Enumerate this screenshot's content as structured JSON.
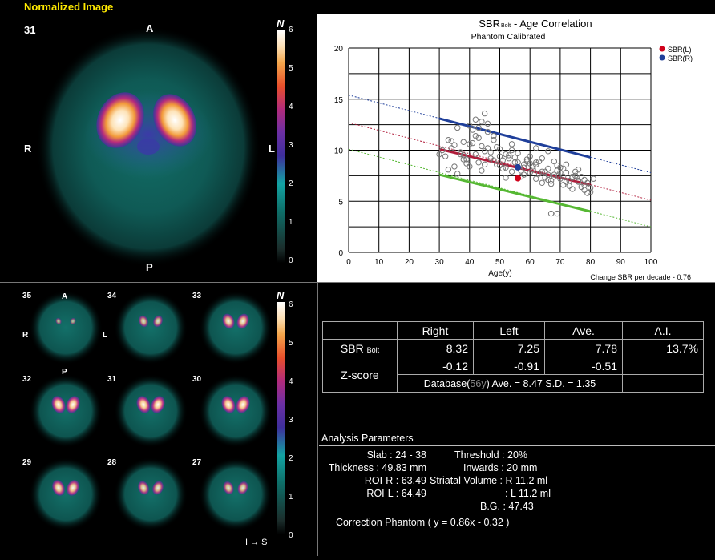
{
  "header": {
    "title": "Normalized Image"
  },
  "main_image": {
    "slice_number": "31",
    "orientation": {
      "anterior": "A",
      "posterior": "P",
      "right": "R",
      "left": "L"
    },
    "colorbar": {
      "label": "N",
      "ticks": [
        "6",
        "5",
        "4",
        "3",
        "2",
        "1",
        "0"
      ]
    }
  },
  "thumbnails": {
    "orientation": {
      "anterior": "A",
      "posterior": "P",
      "right": "R",
      "left": "L"
    },
    "slices": [
      "35",
      "34",
      "33",
      "32",
      "31",
      "30",
      "29",
      "28",
      "27"
    ],
    "colorbar": {
      "label": "N",
      "ticks": [
        "6",
        "5",
        "4",
        "3",
        "2",
        "1",
        "0"
      ]
    },
    "direction_label": "I → S"
  },
  "chart": {
    "title_main": "SBR",
    "title_sub": "Bolt",
    "title_rest": " - Age Correlation",
    "subtitle": "Phantom Calibrated",
    "xlabel": "Age(y)",
    "footnote": "Change SBR per decade - 0.76",
    "legend": [
      {
        "label": "SBR(L)",
        "color": "#d0021b"
      },
      {
        "label": "SBR(R)",
        "color": "#1f3f9a"
      }
    ]
  },
  "chart_data": {
    "type": "scatter",
    "title": "SBRBolt - Age Correlation",
    "subtitle": "Phantom Calibrated",
    "xlabel": "Age(y)",
    "ylabel": "",
    "xlim": [
      0,
      100
    ],
    "ylim": [
      0,
      20
    ],
    "xticks": [
      0,
      10,
      20,
      30,
      40,
      50,
      60,
      70,
      80,
      90,
      100
    ],
    "yticks": [
      0,
      5,
      10,
      15,
      20
    ],
    "grid": true,
    "legend_position": "top-right",
    "regression_lines": [
      {
        "name": "upper",
        "color": "#1f3f9a",
        "x": [
          30,
          80
        ],
        "y": [
          13.1,
          9.3
        ],
        "extended_x": [
          0,
          100
        ],
        "extended_y": [
          15.4,
          7.8
        ]
      },
      {
        "name": "mean",
        "color": "#b01b3a",
        "x": [
          30,
          80
        ],
        "y": [
          10.1,
          6.6
        ],
        "extended_x": [
          0,
          100
        ],
        "extended_y": [
          12.7,
          5.1
        ]
      },
      {
        "name": "lower",
        "color": "#56b833",
        "x": [
          30,
          80
        ],
        "y": [
          7.6,
          4.0
        ],
        "extended_x": [
          0,
          100
        ],
        "extended_y": [
          10.1,
          2.5
        ]
      }
    ],
    "series": [
      {
        "name": "SBR(L)",
        "color": "#d0021b",
        "x": [
          56
        ],
        "y": [
          7.25
        ]
      },
      {
        "name": "SBR(R)",
        "color": "#1f3f9a",
        "x": [
          56
        ],
        "y": [
          8.32
        ]
      }
    ],
    "database_points": {
      "x": [
        31,
        32,
        33,
        34,
        35,
        36,
        37,
        38,
        39,
        40,
        41,
        42,
        43,
        44,
        45,
        46,
        47,
        48,
        49,
        50,
        51,
        52,
        53,
        54,
        55,
        56,
        57,
        58,
        59,
        60,
        61,
        62,
        63,
        64,
        65,
        66,
        67,
        68,
        69,
        70,
        71,
        72,
        73,
        74,
        75,
        76,
        77,
        78,
        79,
        80,
        81,
        33,
        36,
        38,
        40,
        42,
        44,
        46,
        48,
        50,
        52,
        54,
        56,
        58,
        60,
        62,
        64,
        66,
        68,
        70,
        72,
        74,
        76,
        78,
        80,
        35,
        39,
        43,
        47,
        51,
        55,
        59,
        63,
        67,
        71,
        75,
        79,
        37,
        41,
        45,
        49,
        53,
        57,
        61,
        65,
        69,
        73,
        77,
        44,
        48,
        52,
        60,
        64,
        68,
        72,
        76,
        42,
        46,
        50,
        54,
        58,
        62,
        66,
        70,
        74,
        78,
        30,
        34,
        38,
        67,
        69,
        71,
        45,
        40,
        43,
        62,
        66
      ],
      "y": [
        10.0,
        9.4,
        11.0,
        10.2,
        8.4,
        12.2,
        9.6,
        10.8,
        9.1,
        10.6,
        12.0,
        11.4,
        8.8,
        10.4,
        9.9,
        12.6,
        9.2,
        11.0,
        8.6,
        10.1,
        9.0,
        8.3,
        9.5,
        7.9,
        8.8,
        9.7,
        7.4,
        8.6,
        9.1,
        7.8,
        8.4,
        7.2,
        8.9,
        6.8,
        7.9,
        8.2,
        7.0,
        7.6,
        8.5,
        7.2,
        6.6,
        7.8,
        7.0,
        6.2,
        7.5,
        6.9,
        6.4,
        7.1,
        5.8,
        6.3,
        7.2,
        8.1,
        7.7,
        9.1,
        8.4,
        9.6,
        8.0,
        10.2,
        9.0,
        8.5,
        7.3,
        10.0,
        8.8,
        7.6,
        9.4,
        8.6,
        7.9,
        7.1,
        8.9,
        7.8,
        6.9,
        7.4,
        8.1,
        6.6,
        5.9,
        10.5,
        8.7,
        11.2,
        9.8,
        8.2,
        9.3,
        8.9,
        7.7,
        6.7,
        8.2,
        7.9,
        6.8,
        9.8,
        10.7,
        8.6,
        10.3,
        9.2,
        8.0,
        8.1,
        7.3,
        8.0,
        6.5,
        7.4,
        12.8,
        11.4,
        9.6,
        8.7,
        9.2,
        7.4,
        8.6,
        7.0,
        13.0,
        11.8,
        9.4,
        10.6,
        8.3,
        8.8,
        7.6,
        8.3,
        7.3,
        6.1,
        9.6,
        10.9,
        9.5,
        3.8,
        3.8,
        7.4,
        13.6,
        12.4,
        12.2,
        10.2,
        9.9
      ]
    }
  },
  "results_table": {
    "headers": [
      "Right",
      "Left",
      "Ave.",
      "A.I."
    ],
    "sbr_label": "SBR",
    "sbr_sub": "Bolt",
    "sbr_values": [
      "8.32",
      "7.25",
      "7.78",
      "13.7%"
    ],
    "z_label": "Z-score",
    "z_values": [
      "-0.12",
      "-0.91",
      "-0.51"
    ],
    "database_prefix": "Database(",
    "database_age": "56y",
    "database_suffix": ") Ave. = 8.47 S.D. = 1.35"
  },
  "analysis": {
    "title": "Analysis Parameters",
    "slab": "Slab : 24 - 38",
    "thickness": "Thickness : 49.83 mm",
    "roi_r": "ROI-R : 63.49",
    "roi_l": "ROI-L : 64.49",
    "threshold": "Threshold : 20%",
    "inwards": "Inwards : 20 mm",
    "striatal_r": "Striatal Volume : R  11.2 ml",
    "striatal_l": ": L  11.2 ml",
    "bg": "B.G. : 47.43",
    "correction": "Correction Phantom ( y = 0.86x - 0.32 )"
  }
}
